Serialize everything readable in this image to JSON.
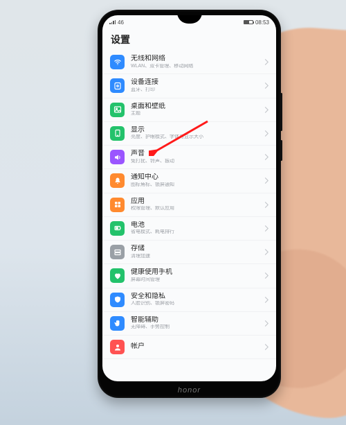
{
  "status": {
    "carrier_label": "46",
    "time": "08:53"
  },
  "page": {
    "title": "设置"
  },
  "rows": [
    {
      "icon": "wifi",
      "iconColor": "#2f8bff",
      "title": "无线和网络",
      "sub": "WLAN、双卡管理、移动网络"
    },
    {
      "icon": "link",
      "iconColor": "#2f8bff",
      "title": "设备连接",
      "sub": "蓝牙、打印"
    },
    {
      "icon": "picture",
      "iconColor": "#23c26b",
      "title": "桌面和壁纸",
      "sub": "主题"
    },
    {
      "icon": "display",
      "iconColor": "#23c26b",
      "title": "显示",
      "sub": "亮度、护眼模式、字体与显示大小"
    },
    {
      "icon": "sound",
      "iconColor": "#9a55ff",
      "title": "声音",
      "sub": "免打扰、铃声、振动"
    },
    {
      "icon": "bell",
      "iconColor": "#ff8a2f",
      "title": "通知中心",
      "sub": "图标角标、锁屏通知"
    },
    {
      "icon": "apps",
      "iconColor": "#ff8a2f",
      "title": "应用",
      "sub": "权限管理、默认应用"
    },
    {
      "icon": "battery",
      "iconColor": "#23c26b",
      "title": "电池",
      "sub": "省电模式、耗电排行"
    },
    {
      "icon": "storage",
      "iconColor": "#9aa0a6",
      "title": "存储",
      "sub": "清理加速"
    },
    {
      "icon": "heart",
      "iconColor": "#23c26b",
      "title": "健康使用手机",
      "sub": "屏幕时间管理"
    },
    {
      "icon": "shield",
      "iconColor": "#2f8bff",
      "title": "安全和隐私",
      "sub": "人脸识别、锁屏密码"
    },
    {
      "icon": "hand",
      "iconColor": "#2f8bff",
      "title": "智能辅助",
      "sub": "无障碍、手势控制"
    },
    {
      "icon": "user",
      "iconColor": "#ff5252",
      "title": "帐户",
      "sub": ""
    }
  ],
  "annotation": {
    "target_row_index": 3
  },
  "brand": "honor"
}
